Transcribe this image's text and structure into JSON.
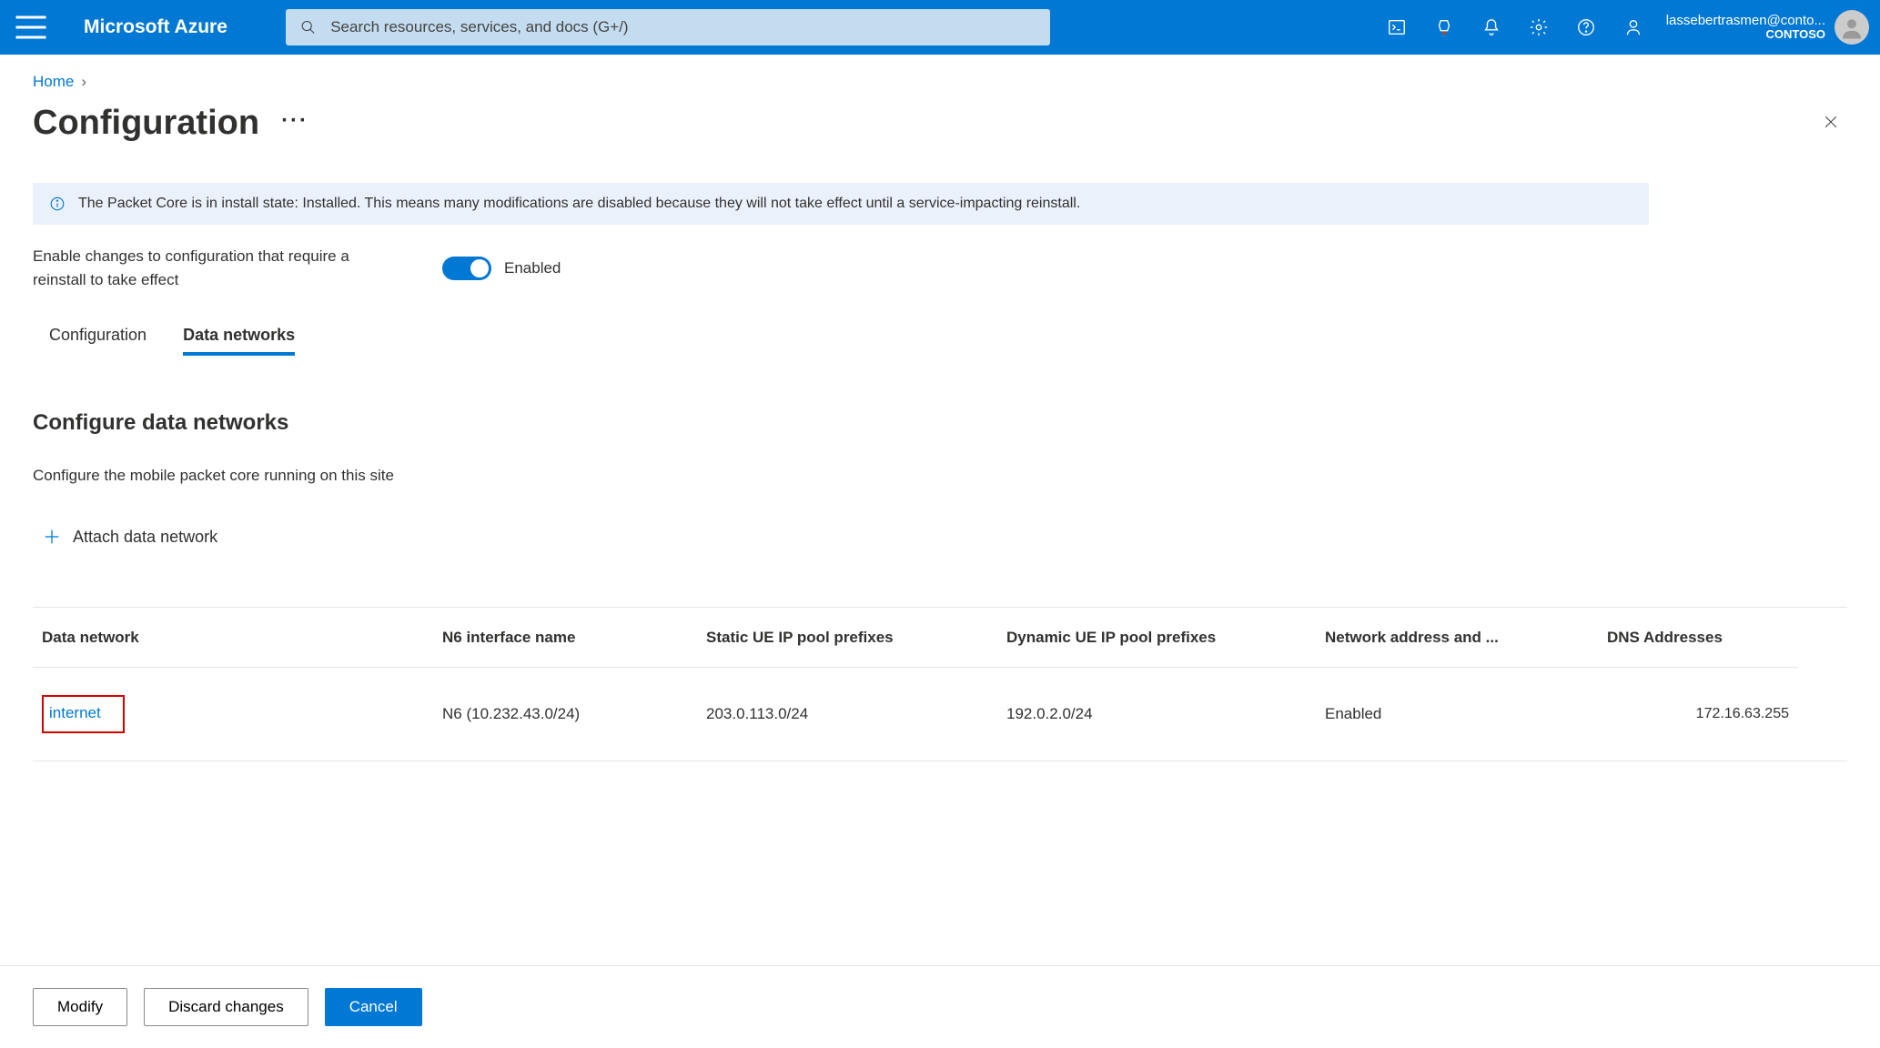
{
  "topbar": {
    "brand": "Microsoft Azure",
    "search_placeholder": "Search resources, services, and docs (G+/)",
    "account_email": "lassebertrasmen@conto...",
    "tenant": "CONTOSO"
  },
  "breadcrumb": {
    "home": "Home"
  },
  "page": {
    "title": "Configuration"
  },
  "banner": {
    "text": "The Packet Core is in install state: Installed. This means many modifications are disabled because they will not take effect until a service-impacting reinstall."
  },
  "toggle": {
    "label": "Enable changes to configuration that require a reinstall to take effect",
    "state_label": "Enabled"
  },
  "tabs": {
    "configuration": "Configuration",
    "data_networks": "Data networks"
  },
  "section": {
    "heading": "Configure data networks",
    "description": "Configure the mobile packet core running on this site",
    "attach_label": "Attach data network"
  },
  "table": {
    "headers": {
      "data_network": "Data network",
      "n6": "N6 interface name",
      "static_ue": "Static UE IP pool prefixes",
      "dynamic_ue": "Dynamic UE IP pool prefixes",
      "nat": "Network address and ...",
      "dns": "DNS Addresses"
    },
    "rows": [
      {
        "data_network": "internet",
        "n6": "N6 (10.232.43.0/24)",
        "static_ue": "203.0.113.0/24",
        "dynamic_ue": "192.0.2.0/24",
        "nat": "Enabled",
        "dns": "172.16.63.255"
      }
    ]
  },
  "footer": {
    "modify": "Modify",
    "discard": "Discard changes",
    "cancel": "Cancel"
  }
}
